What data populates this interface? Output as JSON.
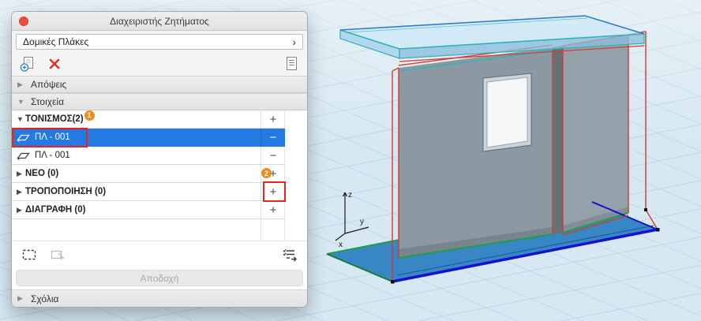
{
  "window": {
    "title": "Διαχειριστής Ζητήματος"
  },
  "filter": {
    "value": "Δομικές Πλάκες"
  },
  "sections": {
    "views": {
      "label": "Απόψεις"
    },
    "elements": {
      "label": "Στοιχεία"
    },
    "comments": {
      "label": "Σχόλια"
    }
  },
  "tree": {
    "groups": [
      {
        "label": "ΤΟΝΙΣΜΟΣ(2)",
        "badge": "1",
        "action": "+",
        "items": [
          {
            "label": "ΠΛ - 001",
            "action": "−",
            "selected": true
          },
          {
            "label": "ΠΛ - 001",
            "action": "−",
            "selected": false
          }
        ]
      },
      {
        "label": "ΝΕΟ (0)",
        "badge": "2",
        "action": "+"
      },
      {
        "label": "ΤΡΟΠΟΠΟΙΗΣΗ (0)",
        "action": "+",
        "action_highlighted": true
      },
      {
        "label": "ΔΙΑΓΡΑΦΗ (0)",
        "action": "+"
      }
    ]
  },
  "footer": {
    "accept_label": "Αποδοχή"
  },
  "viewport": {
    "axis": {
      "x": "x",
      "y": "y",
      "z": "z"
    }
  },
  "colors": {
    "selection": "#2579e2",
    "badge": "#f08b1f",
    "annotation": "#e8251c",
    "delete": "#de3226",
    "floor": "#3081c1",
    "roof-edge": "#2fb3b8",
    "modified": "#d9382c",
    "base-line": "#1d9e49",
    "front-edge": "#1212cf"
  }
}
